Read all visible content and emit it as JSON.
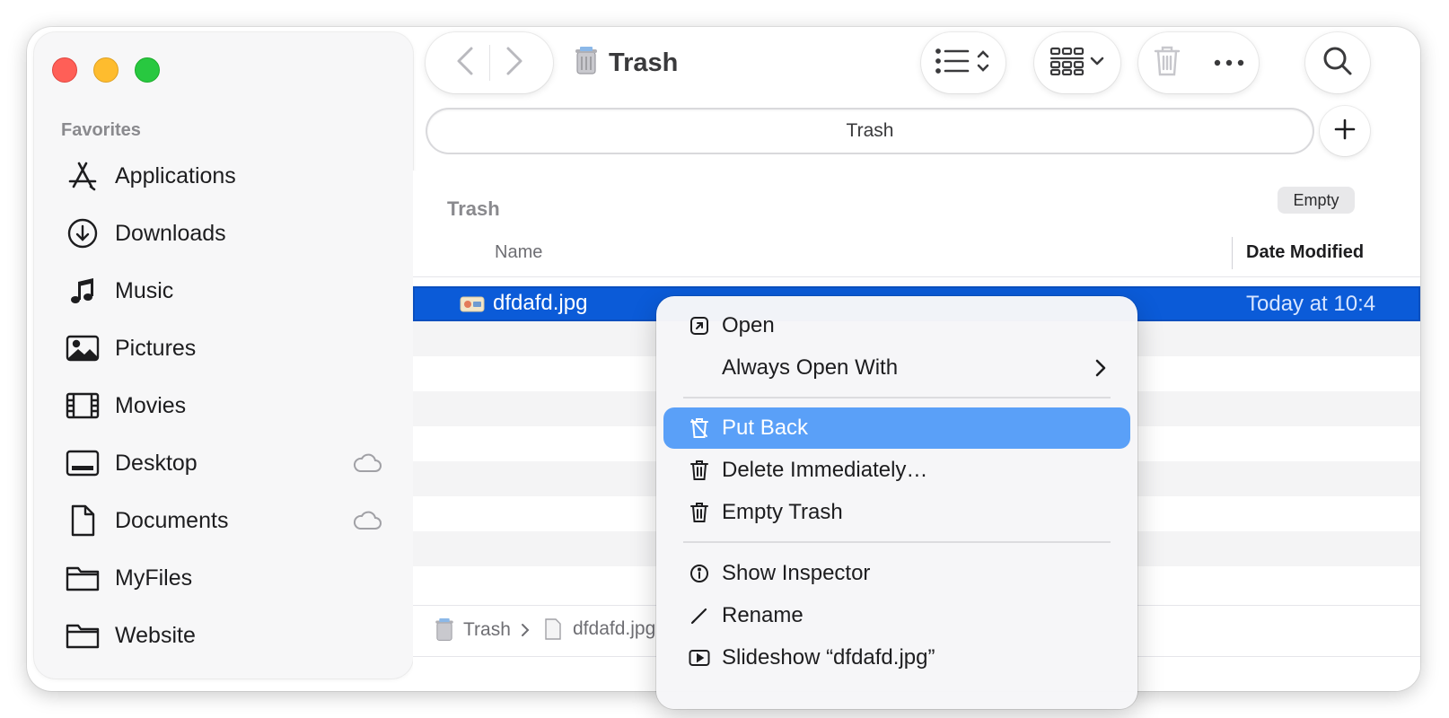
{
  "sidebar": {
    "section_title": "Favorites",
    "items": [
      {
        "label": "Applications",
        "icon": "applications-icon",
        "cloud": false
      },
      {
        "label": "Downloads",
        "icon": "downloads-icon",
        "cloud": false
      },
      {
        "label": "Music",
        "icon": "music-icon",
        "cloud": false
      },
      {
        "label": "Pictures",
        "icon": "pictures-icon",
        "cloud": false
      },
      {
        "label": "Movies",
        "icon": "movies-icon",
        "cloud": false
      },
      {
        "label": "Desktop",
        "icon": "desktop-icon",
        "cloud": true
      },
      {
        "label": "Documents",
        "icon": "documents-icon",
        "cloud": true
      },
      {
        "label": "MyFiles",
        "icon": "folder-icon",
        "cloud": false
      },
      {
        "label": "Website",
        "icon": "folder-icon",
        "cloud": false
      }
    ]
  },
  "toolbar": {
    "title": "Trash"
  },
  "tabbar": {
    "active_tab": "Trash"
  },
  "content": {
    "title": "Trash",
    "empty_button": "Empty",
    "columns": {
      "name": "Name",
      "date": "Date Modified"
    },
    "selected_file": {
      "name": "dfdafd.jpg",
      "date": "Today at 10:4"
    }
  },
  "pathbar": {
    "segments": [
      "Trash",
      "dfdafd.jpg"
    ]
  },
  "context_menu": {
    "items": [
      {
        "label": "Open",
        "icon": "open-icon"
      },
      {
        "label": "Always Open With",
        "icon": "",
        "submenu": true
      },
      {
        "label": "Put Back",
        "icon": "put-back-icon",
        "highlighted": true
      },
      {
        "label": "Delete Immediately…",
        "icon": "trash-icon"
      },
      {
        "label": "Empty Trash",
        "icon": "trash-icon"
      },
      {
        "label": "Show Inspector",
        "icon": "info-icon"
      },
      {
        "label": "Rename",
        "icon": "pencil-icon"
      },
      {
        "label": "Slideshow “dfdafd.jpg”",
        "icon": "slideshow-icon"
      }
    ]
  },
  "colors": {
    "selection": "#0b5bd8",
    "menu_highlight": "#5aa0f8",
    "close": "#ff5f57",
    "minimize": "#febc2e",
    "zoom": "#28c840"
  }
}
